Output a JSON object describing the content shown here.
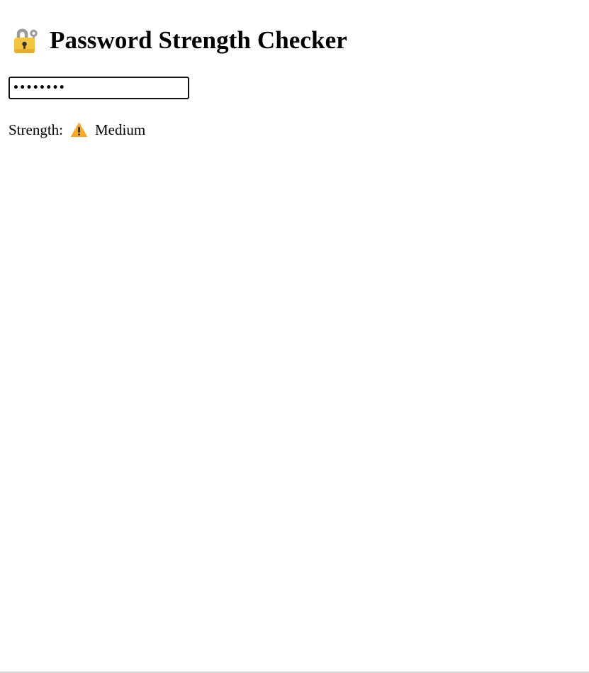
{
  "header": {
    "icon": "padlock-with-key-icon",
    "title": "Password Strength Checker"
  },
  "password": {
    "value": "••••••••",
    "input_type": "password"
  },
  "strength": {
    "label": "Strength:",
    "icon": "warning-icon",
    "value": "Medium"
  },
  "colors": {
    "lock_body": "#f4c542",
    "lock_shackle": "#9b9b9b",
    "warning": "#f7a928",
    "text": "#000000"
  }
}
